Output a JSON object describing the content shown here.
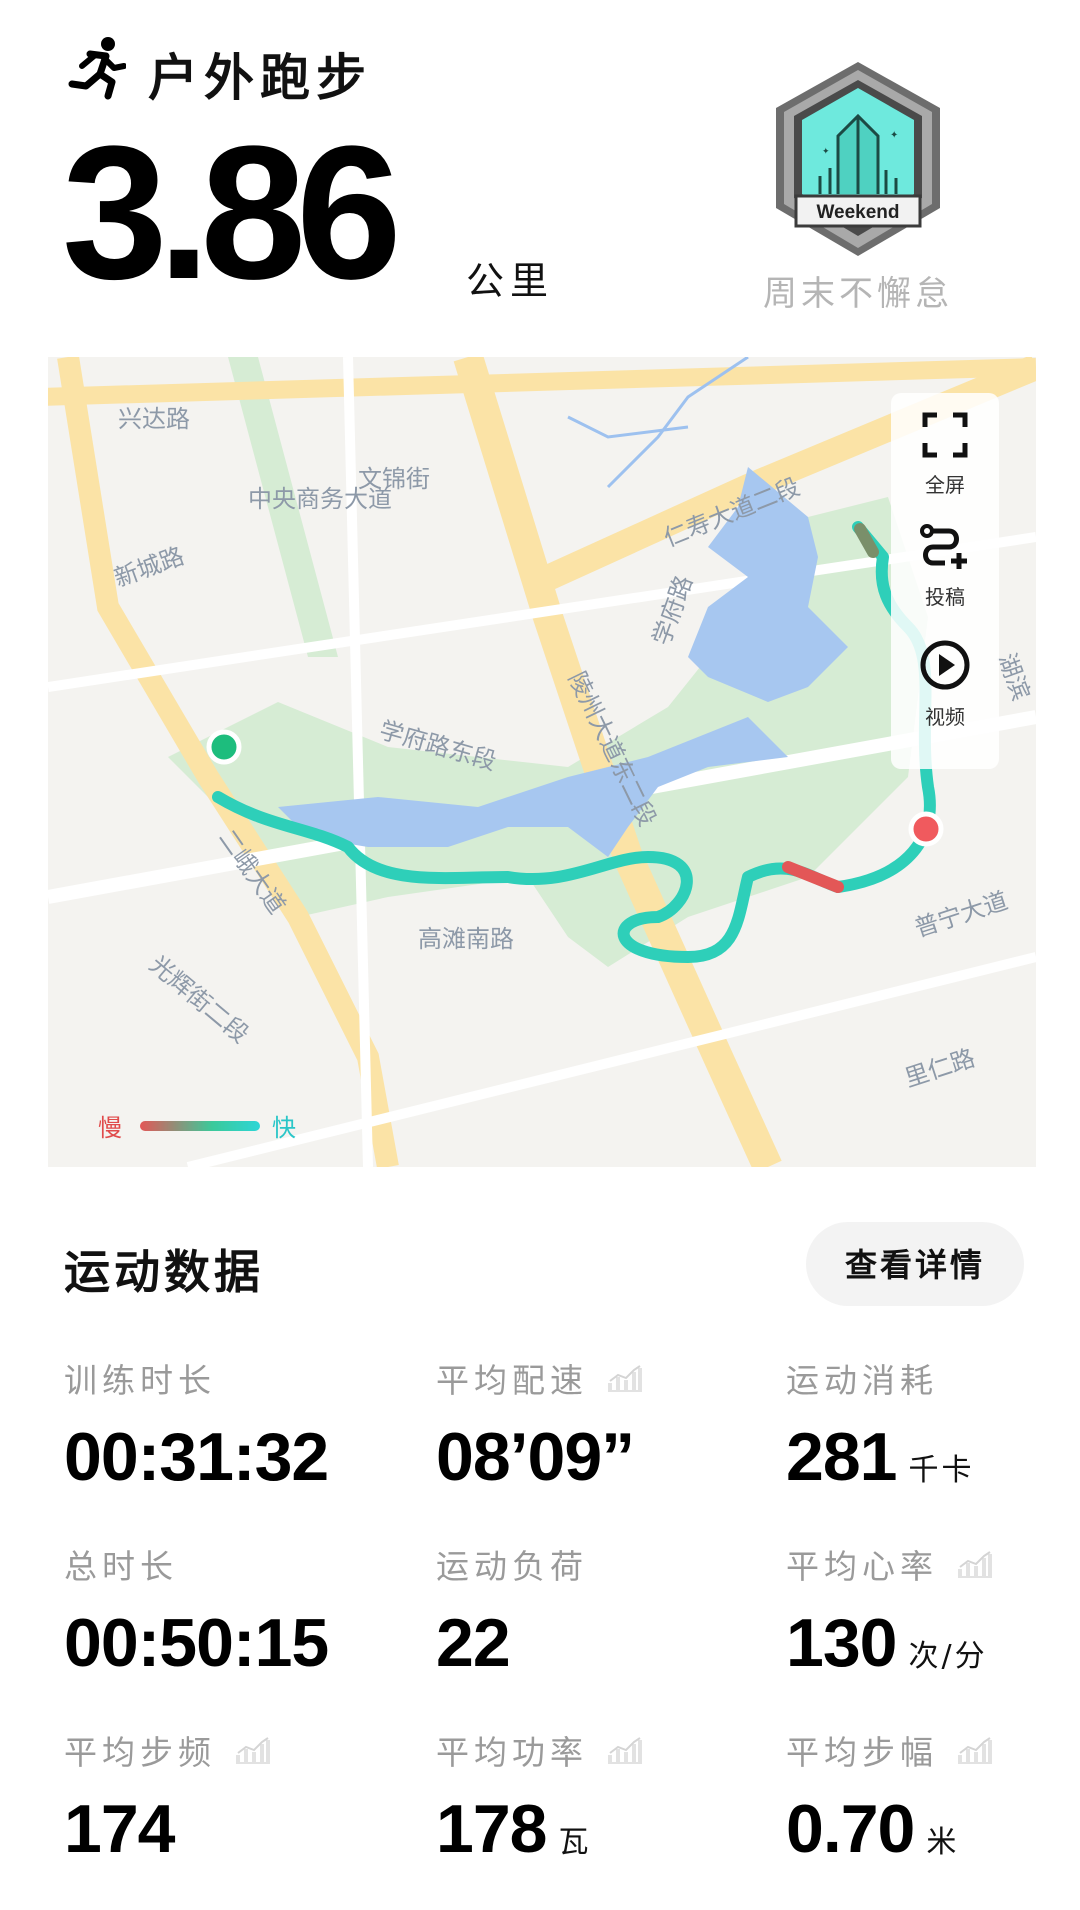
{
  "header": {
    "activity_title": "户外跑步",
    "distance": "3.86",
    "distance_unit": "公里",
    "badge_text": "Weekend",
    "badge_caption": "周末不懈怠"
  },
  "map": {
    "controls": [
      {
        "label": "全屏",
        "icon": "fullscreen-icon"
      },
      {
        "label": "投稿",
        "icon": "route-submit-icon"
      },
      {
        "label": "视频",
        "icon": "play-video-icon"
      }
    ],
    "legend": {
      "slow": "慢",
      "fast": "快"
    },
    "street_labels": [
      "兴达路",
      "中央商务大道",
      "文锦街",
      "新城路",
      "仁寿大道二段",
      "学府路",
      "陵州大道东二段",
      "学府路东段",
      "湖滨",
      "二峨大道",
      "高滩南路",
      "普宁大道",
      "光辉街二段",
      "里仁路"
    ],
    "colors": {
      "water": "#a7c7f0",
      "park": "#d6ecd4",
      "road": "#fbe3a6",
      "route": "#2ecfb9",
      "start": "#1dbd7d",
      "end": "#f05a5e"
    }
  },
  "stats_section": {
    "title": "运动数据",
    "details_button": "查看详情",
    "items": [
      {
        "label": "训练时长",
        "value": "00:31:32",
        "unit": "",
        "chart": false
      },
      {
        "label": "平均配速",
        "value": "08’09”",
        "unit": "",
        "chart": true
      },
      {
        "label": "运动消耗",
        "value": "281",
        "unit": "千卡",
        "chart": false
      },
      {
        "label": "总时长",
        "value": "00:50:15",
        "unit": "",
        "chart": false
      },
      {
        "label": "运动负荷",
        "value": "22",
        "unit": "",
        "chart": false
      },
      {
        "label": "平均心率",
        "value": "130",
        "unit": "次/分",
        "chart": true
      },
      {
        "label": "平均步频",
        "value": "174",
        "unit": "",
        "chart": true
      },
      {
        "label": "平均功率",
        "value": "178",
        "unit": "瓦",
        "chart": true
      },
      {
        "label": "平均步幅",
        "value": "0.70",
        "unit": "米",
        "chart": true
      }
    ]
  }
}
